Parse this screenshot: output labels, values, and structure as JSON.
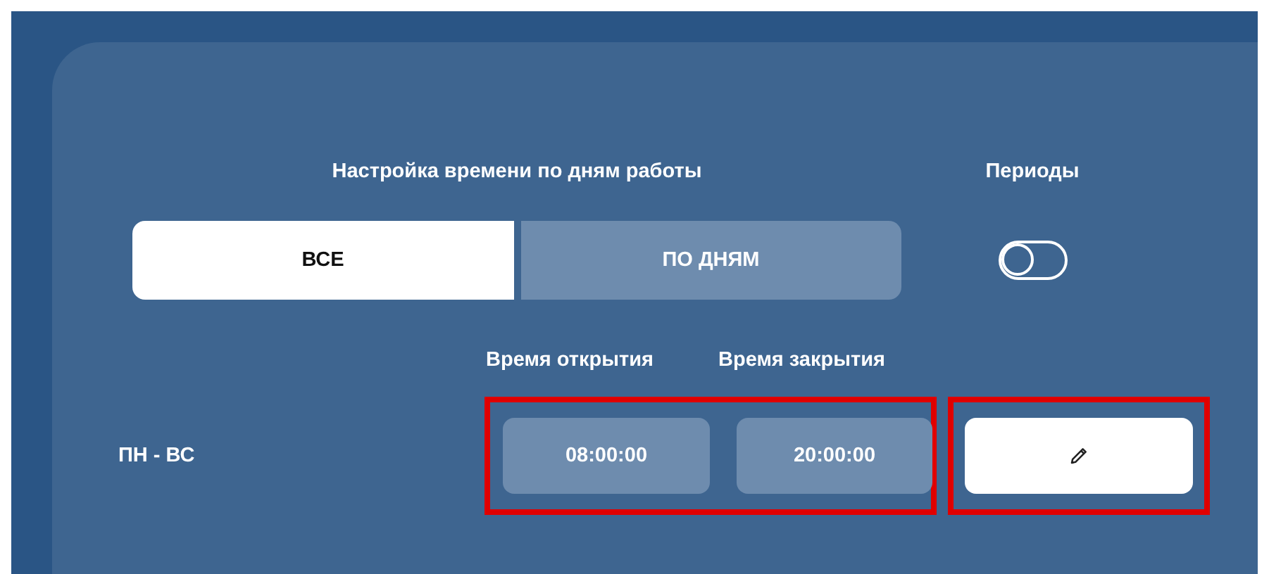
{
  "mode_heading": "Настройка времени по дням работы",
  "mode_tabs": [
    {
      "label": "ВСЕ",
      "selected": true
    },
    {
      "label": "ПО ДНЯМ",
      "selected": false
    }
  ],
  "periods": {
    "label": "Периоды",
    "on": false
  },
  "columns": [
    "Время открытия",
    "Время закрытия"
  ],
  "rows": [
    {
      "days": "ПН - ВС",
      "open": "08:00:00",
      "close": "20:00:00",
      "times_highlighted": true,
      "edit_highlighted": true
    }
  ]
}
